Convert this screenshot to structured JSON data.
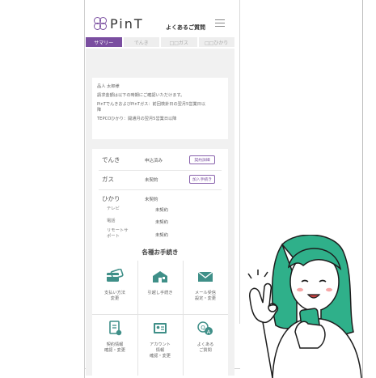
{
  "header": {
    "logo_text": "PinT",
    "faq_label": "よくあるご質問"
  },
  "tabs": [
    {
      "label": "サマリー",
      "active": true
    },
    {
      "label": "でんき",
      "active": false
    },
    {
      "label": "□□ガス",
      "active": false
    },
    {
      "label": "□□ひかり",
      "active": false
    }
  ],
  "summary": {
    "lines": [
      "品人 太郎様",
      "請求金額は以下の時期にご確認いただけます。",
      "PinTでんきおよびPinTガス：前回検針日の翌月5営業日以",
      "降",
      "TEPCOひかり：開通月の翌月5営業日以降"
    ]
  },
  "contracts": {
    "electric": {
      "label": "でんき",
      "status": "申込済み",
      "button": "契約詳細"
    },
    "gas": {
      "label": "ガス",
      "status": "未契約",
      "button": "加入手続き"
    },
    "hikari": {
      "label": "ひかり",
      "status": "未契約"
    },
    "sub_items": [
      {
        "label": "テレビ",
        "status": "未契約"
      },
      {
        "label": "電話",
        "status": "未契約"
      },
      {
        "label": "リモートサ\nポート",
        "status": "未契約"
      }
    ]
  },
  "procedures": {
    "title": "各種お手続き",
    "items": [
      {
        "label": "支払い方法\n変更",
        "icon": "card-icon"
      },
      {
        "label": "引越し手続き",
        "icon": "house-icon"
      },
      {
        "label": "メール受信\n設定・変更",
        "icon": "mail-icon"
      },
      {
        "label": "契約情報\n確認・変更",
        "icon": "document-icon"
      },
      {
        "label": "アカウント\n情報\n確認・変更",
        "icon": "id-card-icon"
      },
      {
        "label": "よくある\nご質問",
        "icon": "qa-icon"
      }
    ]
  },
  "colors": {
    "brand": "#7a4ea0",
    "icon": "#3f8f88",
    "background": "#f1f1f1"
  }
}
